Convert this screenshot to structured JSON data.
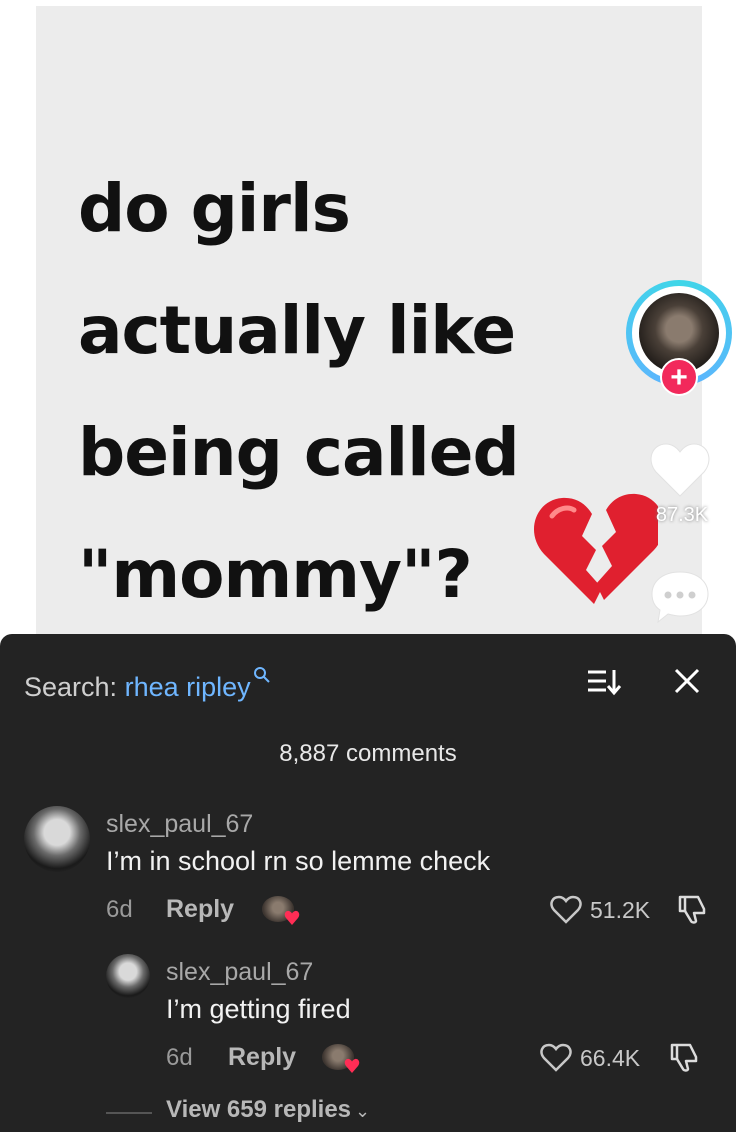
{
  "video": {
    "lines": [
      "do girls",
      "actually like",
      "being called",
      "\"mommy\"?"
    ],
    "emoji": "broken-heart-emoji"
  },
  "rail": {
    "like_count": "87.3K",
    "follow_symbol": "+"
  },
  "comments_sheet": {
    "search_prefix": "Search:",
    "search_term": "rhea ripley",
    "count_label": "8,887 comments",
    "comments": [
      {
        "username": "slex_paul_67",
        "text": "I’m in school rn so lemme check",
        "time": "6d",
        "reply_label": "Reply",
        "likes": "51.2K"
      },
      {
        "username": "slex_paul_67",
        "text": "I’m getting fired",
        "time": "6d",
        "reply_label": "Reply",
        "likes": "66.4K"
      }
    ],
    "view_replies": "View 659 replies"
  },
  "colors": {
    "accent_link": "#6fb6ff",
    "follow_red": "#f2295b",
    "sheet_bg": "#232323"
  }
}
